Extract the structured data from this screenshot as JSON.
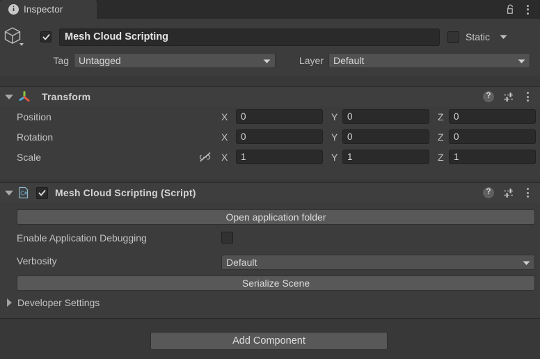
{
  "window": {
    "tab_label": "Inspector",
    "tab_icon": "info-icon",
    "lock_icon": "unlocked-padlock-icon",
    "menu_icon": "kebab-menu-icon"
  },
  "object_header": {
    "icon": "gameobject-cube-icon",
    "enabled_checkbox": true,
    "name_value": "Mesh Cloud Scripting",
    "static_label": "Static",
    "static_checked": false,
    "static_dropdown_icon": "chevron-down-icon",
    "tag_label": "Tag",
    "tag_value": "Untagged",
    "layer_label": "Layer",
    "layer_value": "Default"
  },
  "transform": {
    "title": "Transform",
    "icon": "transform-axis-gizmo-icon",
    "help_icon": "help-icon",
    "preset_icon": "preset-settings-icon",
    "menu_icon": "kebab-menu-icon",
    "rows": [
      {
        "label": "Position",
        "x": "0",
        "y": "0",
        "z": "0"
      },
      {
        "label": "Rotation",
        "x": "0",
        "y": "0",
        "z": "0"
      },
      {
        "label": "Scale",
        "x": "1",
        "y": "1",
        "z": "1"
      }
    ],
    "axis_labels": {
      "x": "X",
      "y": "Y",
      "z": "Z"
    },
    "constrain_icon": "constrain-proportions-off-icon"
  },
  "script_component": {
    "title": "Mesh Cloud Scripting (Script)",
    "icon": "csharp-script-icon",
    "enabled_checkbox": true,
    "help_icon": "help-icon",
    "preset_icon": "preset-settings-icon",
    "menu_icon": "kebab-menu-icon",
    "open_folder_button": "Open application folder",
    "debug_label": "Enable Application Debugging",
    "debug_checked": false,
    "verbosity_label": "Verbosity",
    "verbosity_value": "Default",
    "serialize_button": "Serialize Scene",
    "developer_settings_label": "Developer Settings",
    "developer_settings_expanded": false
  },
  "footer": {
    "add_component_label": "Add Component"
  },
  "colors": {
    "panel_bg": "#3c3c3c",
    "header_bg": "#3e3e3e",
    "tab_bg": "#3c3c3c",
    "strip_bg": "#2b2b2b",
    "field_bg": "#2a2a2a",
    "button_bg": "#585858",
    "text": "#c4c4c4",
    "axis_green": "#8cc63f",
    "axis_red": "#e8563f",
    "axis_blue": "#4aa8d8",
    "csharp_blue": "#6fb8dd"
  }
}
